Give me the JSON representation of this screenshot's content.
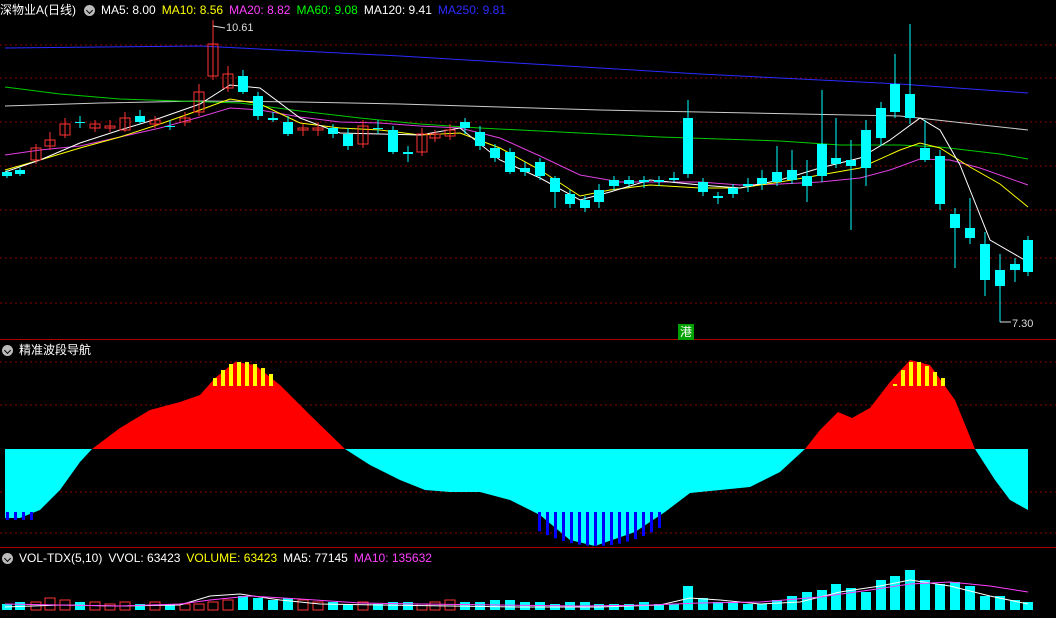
{
  "price_panel": {
    "symbol": "深物业A(日线)",
    "ma": [
      {
        "label": "MA5: 8.00",
        "color": "#ffffff"
      },
      {
        "label": "MA10: 8.56",
        "color": "#ffff00"
      },
      {
        "label": "MA20: 8.82",
        "color": "#ff40ff"
      },
      {
        "label": "MA60: 9.08",
        "color": "#00ff00"
      },
      {
        "label": "MA120: 9.41",
        "color": "#ffffff"
      },
      {
        "label": "MA250: 9.81",
        "color": "#2b2bff"
      }
    ],
    "high_mark": "10.61",
    "low_mark": "7.30",
    "hk_badge": "港"
  },
  "indicator_panel": {
    "title": "精准波段导航"
  },
  "volume_panel": {
    "title": "VOL-TDX(5,10)",
    "vvol": "VVOL: 63423",
    "volume": "VOLUME: 63423",
    "ma5": "MA5: 77145",
    "ma10": "MA10: 135632"
  },
  "colors": {
    "up": "#ff3232",
    "down": "#00ffff",
    "grid": "#8b0000",
    "border": "#b00000"
  }
}
